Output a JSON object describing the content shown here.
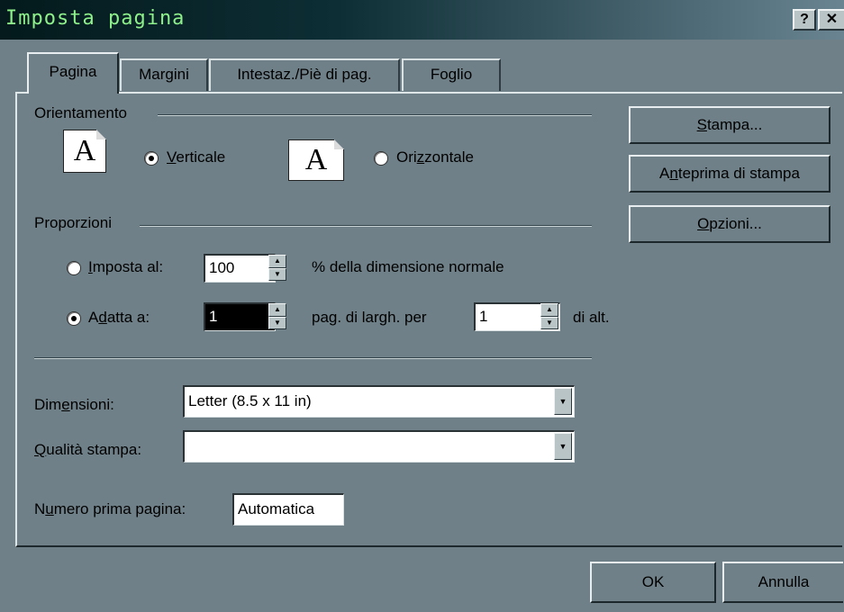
{
  "window": {
    "title": "Imposta pagina",
    "help_button": "?",
    "close_button": "✕"
  },
  "tabs": [
    {
      "label": "Pagina",
      "active": true
    },
    {
      "label": "Margini",
      "active": false
    },
    {
      "label": "Intestaz./Piè di pag.",
      "active": false
    },
    {
      "label": "Foglio",
      "active": false
    }
  ],
  "orientation": {
    "group_label": "Orientamento",
    "portrait_label": "Verticale",
    "landscape_label": "Orizzontale",
    "selected": "portrait",
    "icon_letter": "A"
  },
  "scaling": {
    "group_label": "Proporzioni",
    "adjust_label": "Imposta al:",
    "adjust_value": "100",
    "adjust_suffix": "% della dimensione normale",
    "fit_label": "Adatta a:",
    "fit_wide_value": "1",
    "fit_middle": "pag. di largh. per",
    "fit_tall_value": "1",
    "fit_suffix": "di alt.",
    "selected": "fit"
  },
  "paper": {
    "size_label": "Dimensioni:",
    "size_value": "Letter (8.5 x 11 in)",
    "quality_label": "Qualità stampa:",
    "quality_value": "",
    "first_page_label": "Numero prima pagina:",
    "first_page_value": "Automatica"
  },
  "side_buttons": {
    "print": "Stampa...",
    "preview": "Anteprima di stampa",
    "options": "Opzioni..."
  },
  "footer": {
    "ok": "OK",
    "cancel": "Annulla"
  },
  "colors": {
    "dialog_background": "#6f8088",
    "title_text": "#8ef08a"
  }
}
